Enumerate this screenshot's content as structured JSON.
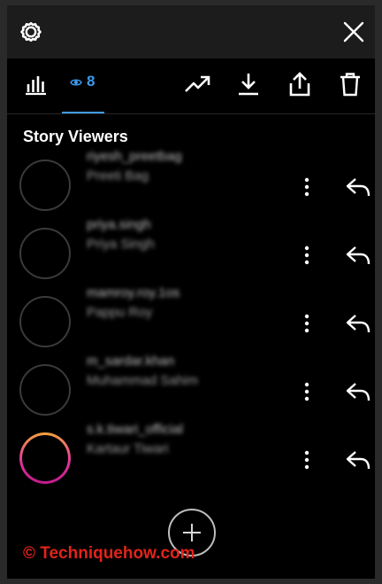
{
  "tabs": {
    "viewers_count": "8"
  },
  "section": {
    "title": "Story Viewers"
  },
  "viewers": [
    {
      "username": "riyesh_preetbag",
      "name": "Preeti Bag",
      "story_ring": false
    },
    {
      "username": "priya.singh",
      "name": "Priya Singh",
      "story_ring": false
    },
    {
      "username": "mamroy.roy.1os",
      "name": "Pappu Roy",
      "story_ring": false
    },
    {
      "username": "m_sardar.khan",
      "name": "Muhammad Sahim",
      "story_ring": false
    },
    {
      "username": "s.k.tiwari_official",
      "name": "Kartaur Tiwari",
      "story_ring": true
    }
  ],
  "watermark": "© Techniquehow.com",
  "colors": {
    "accent": "#3d9bf0",
    "watermark": "#e2231a",
    "background": "#000000",
    "topbar": "#1c1c1c"
  },
  "icons": {
    "topbar": [
      "gear-icon",
      "close-icon"
    ],
    "toolbar": [
      "stats-bar-icon",
      "eye-icon",
      "trending-icon",
      "download-icon",
      "share-icon",
      "trash-icon"
    ],
    "row": [
      "more-vertical-icon",
      "reply-icon"
    ],
    "fab": "plus-icon"
  }
}
